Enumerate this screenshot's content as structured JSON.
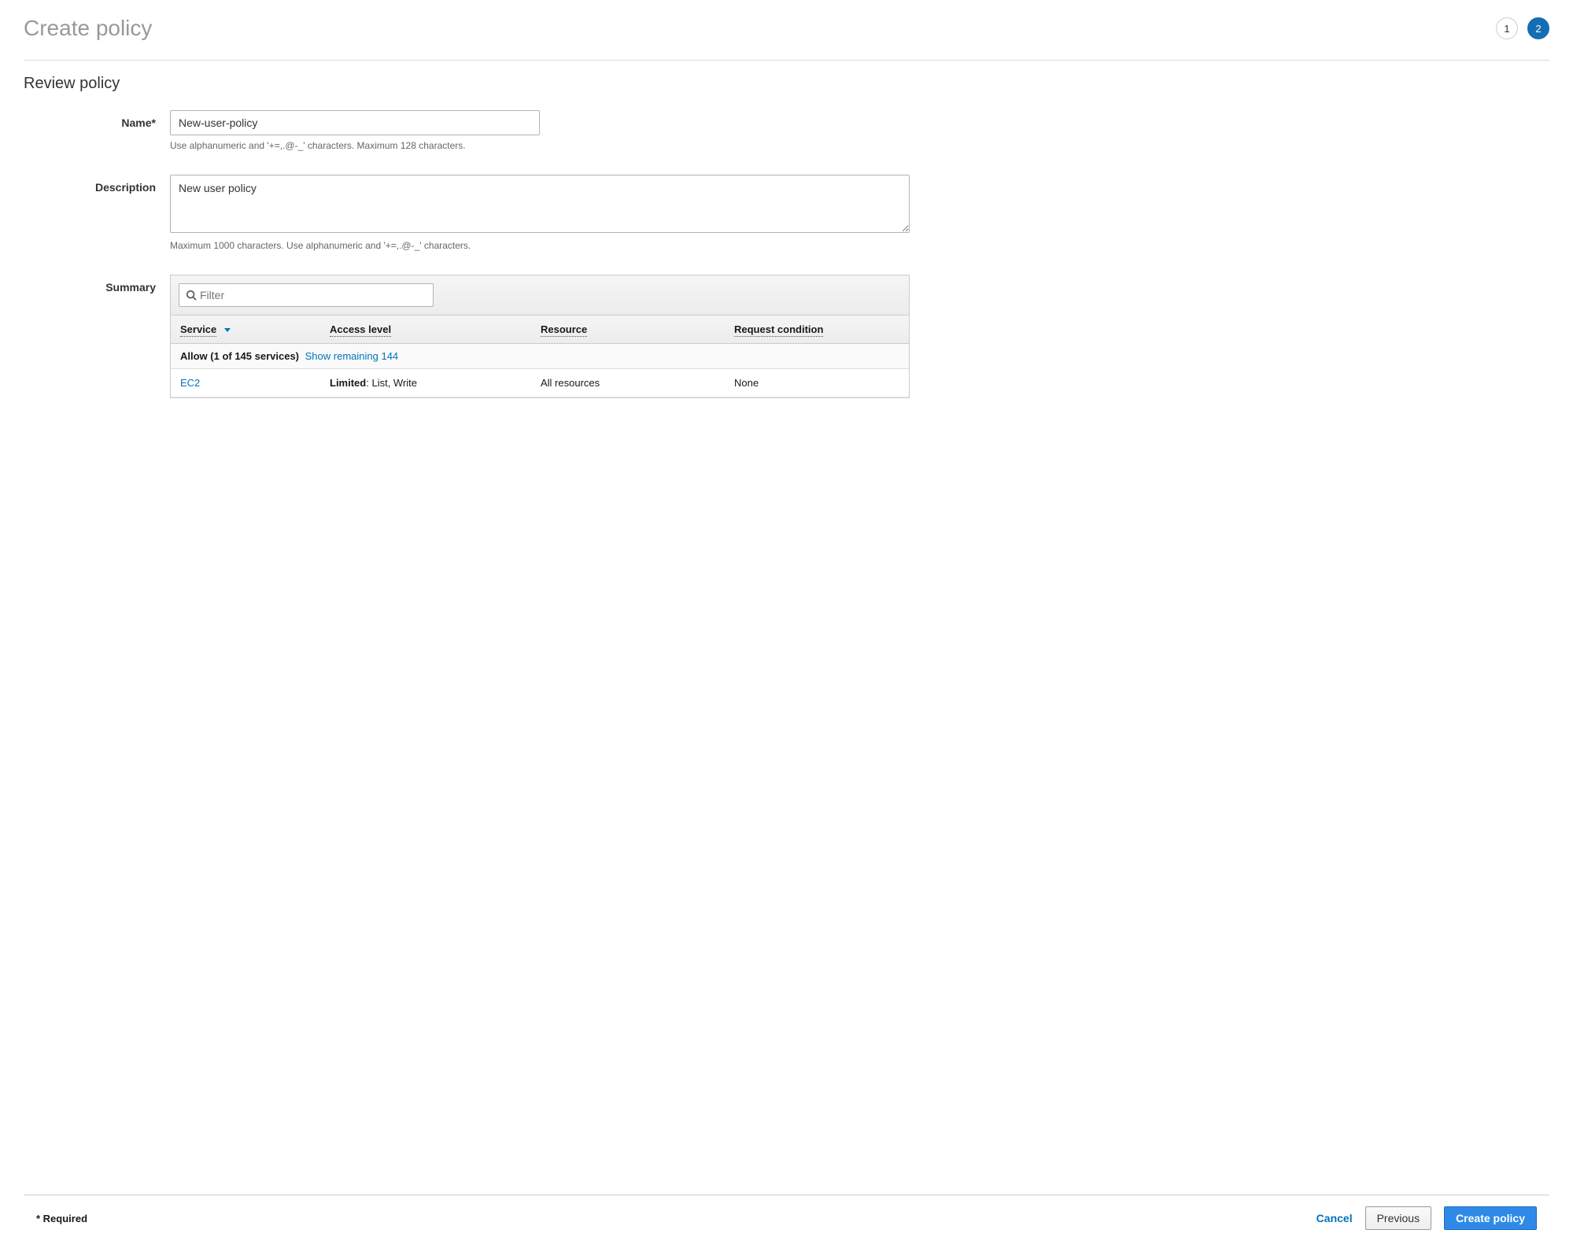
{
  "header": {
    "title": "Create policy",
    "steps": {
      "step1": "1",
      "step2": "2"
    }
  },
  "section": {
    "title": "Review policy"
  },
  "form": {
    "name_label": "Name*",
    "name_value": "New-user-policy",
    "name_hint": "Use alphanumeric and '+=,.@-_' characters. Maximum 128 characters.",
    "desc_label": "Description",
    "desc_value": "New user policy",
    "desc_hint": "Maximum 1000 characters. Use alphanumeric and '+=,.@-_' characters.",
    "summary_label": "Summary"
  },
  "summary": {
    "filter_placeholder": "Filter",
    "columns": {
      "service": "Service",
      "access": "Access level",
      "resource": "Resource",
      "request": "Request condition"
    },
    "group": {
      "title": "Allow (1 of 145 services)",
      "link": "Show remaining 144"
    },
    "rows": [
      {
        "service": "EC2",
        "access_prefix": "Limited",
        "access_suffix": ": List, Write",
        "resource": "All resources",
        "request": "None"
      }
    ]
  },
  "footer": {
    "required": "* Required",
    "cancel": "Cancel",
    "previous": "Previous",
    "create": "Create policy"
  }
}
